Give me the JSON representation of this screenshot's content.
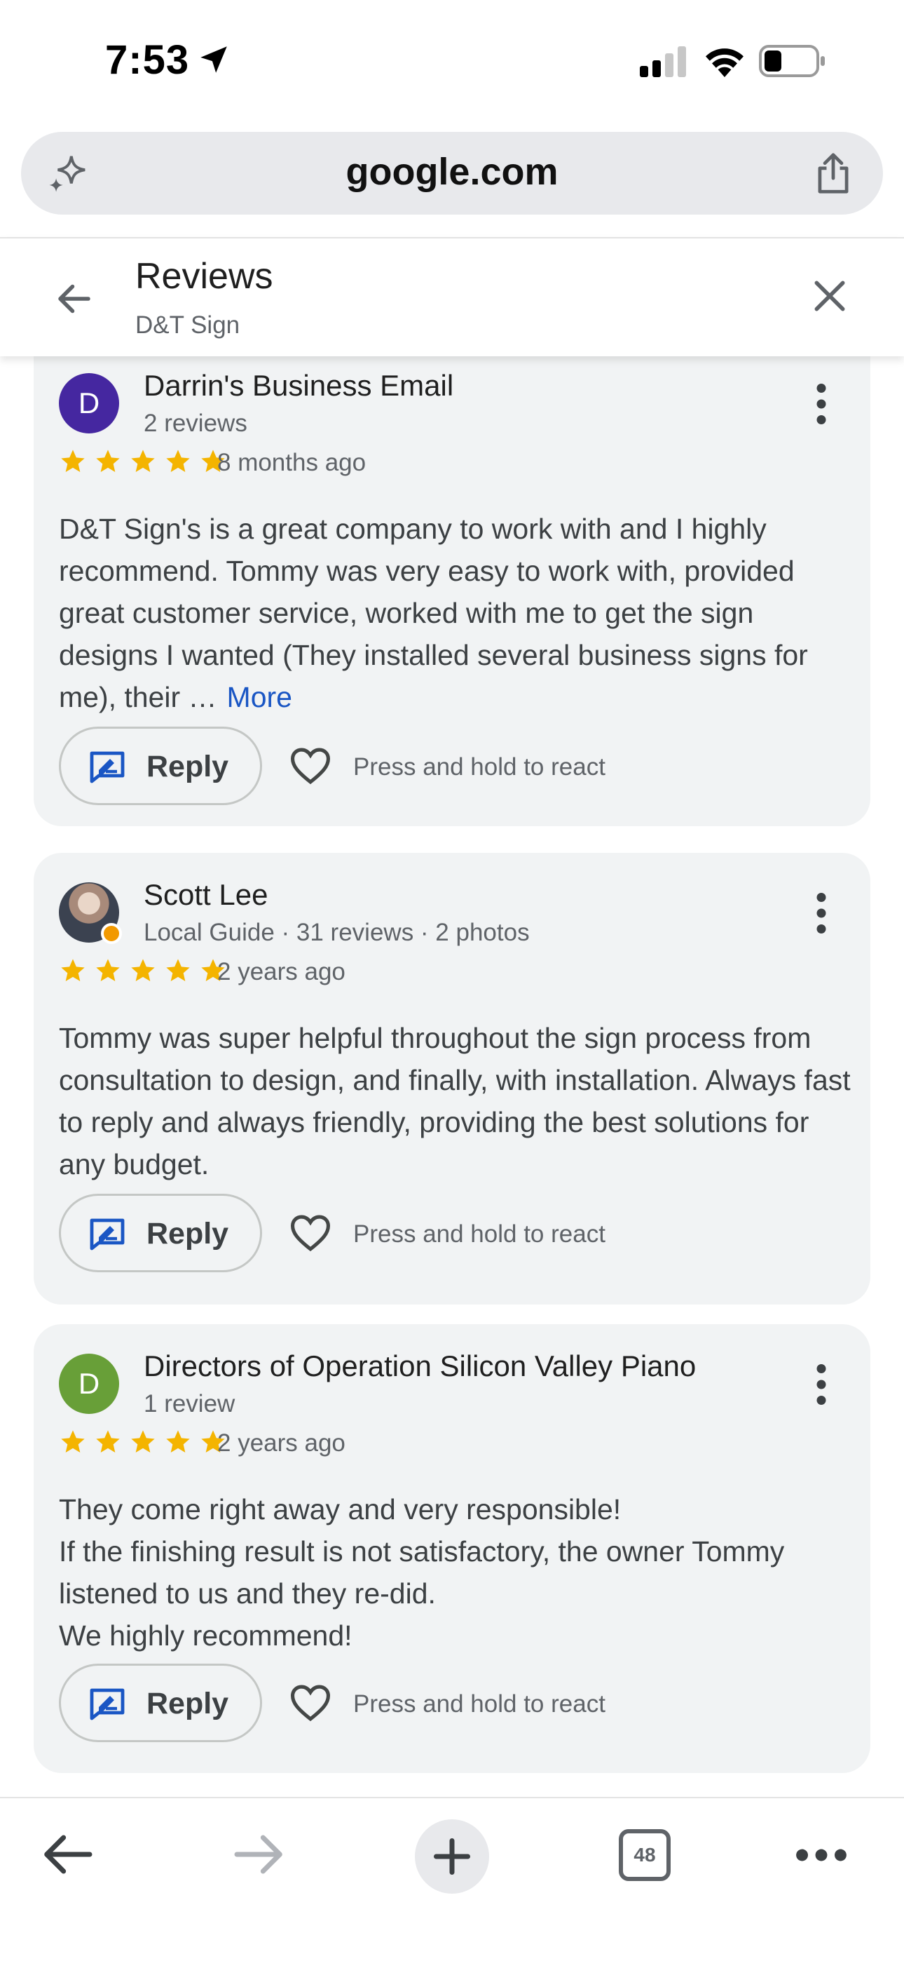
{
  "status_bar": {
    "time": "7:53"
  },
  "browser": {
    "url": "google.com"
  },
  "header": {
    "title": "Reviews",
    "subtitle": "D&T Sign"
  },
  "reviews": [
    {
      "avatar_letter": "D",
      "avatar_color": "#4527a0",
      "name": "Darrin's Business Email",
      "meta": "2 reviews",
      "rating": 5,
      "date": "8 months ago",
      "text": "D&T Sign's is a great company to work with and I highly recommend. Tommy was very easy to work with, provided great customer service, worked with me to get the sign designs I wanted (They installed several business signs for me), their …",
      "more_label": "More",
      "reply_label": "Reply",
      "react_label": "Press and hold to react"
    },
    {
      "avatar_letter": "",
      "avatar_color": "#3b4250",
      "name": "Scott Lee",
      "meta": "Local Guide · 31 reviews · 2 photos",
      "rating": 5,
      "date": "2 years ago",
      "text": "Tommy was super helpful throughout the sign process from consultation to design, and finally, with installation. Always fast to reply and always friendly, providing the best solutions for any budget.",
      "reply_label": "Reply",
      "react_label": "Press and hold to react"
    },
    {
      "avatar_letter": "D",
      "avatar_color": "#689f38",
      "name": "Directors of Operation Silicon Valley Piano",
      "meta": "1 review",
      "rating": 5,
      "date": "2 years ago",
      "text_lines": [
        "They come right away and very responsible!",
        "If the finishing result is not satisfactory, the owner Tommy listened to us and they re-did.",
        "We highly recommend!"
      ],
      "reply_label": "Reply",
      "react_label": "Press and hold to react"
    }
  ],
  "toolbar": {
    "tab_count": "48"
  },
  "colors": {
    "star": "#f4b400",
    "link": "#1a56c4",
    "reply_icon": "#1a56c4",
    "card_bg": "#f1f3f4"
  },
  "icons": [
    "location-arrow-icon",
    "signal-icon",
    "wifi-icon",
    "battery-icon",
    "sparkle-icon",
    "share-icon",
    "back-arrow-icon",
    "close-icon",
    "more-vert-icon",
    "star-icon",
    "reply-icon",
    "heart-icon",
    "forward-arrow-icon",
    "plus-icon",
    "tabs-icon",
    "more-horiz-icon"
  ]
}
